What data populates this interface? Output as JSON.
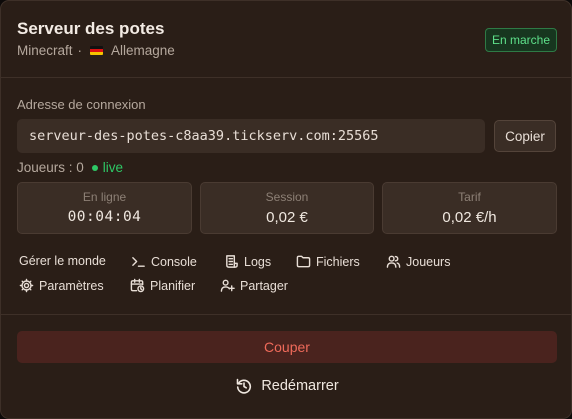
{
  "server": {
    "title": "Serveur des potes",
    "game": "Minecraft",
    "separator": "·",
    "region": "Allemagne",
    "status": "En marche",
    "status_color": "#5ee08a"
  },
  "connection": {
    "label": "Adresse de connexion",
    "address": "serveur-des-potes-c8aa39.tickserv.com:25565",
    "copy_label": "Copier"
  },
  "players": {
    "label": "Joueurs : 0",
    "live_label": "live",
    "live_color": "#2ec866"
  },
  "stats": [
    {
      "label": "En ligne",
      "value": "00:04:04"
    },
    {
      "label": "Session",
      "value": "0,02 €"
    },
    {
      "label": "Tarif",
      "value": "0,02 €/h"
    }
  ],
  "actions": {
    "manage_world": "Gérer le monde",
    "console": "Console",
    "logs": "Logs",
    "files": "Fichiers",
    "players": "Joueurs",
    "settings": "Paramètres",
    "schedule": "Planifier",
    "share": "Partager"
  },
  "buttons": {
    "stop": "Couper",
    "restart": "Redémarrer"
  },
  "icons": [
    "flag-germany-icon",
    "terminal-icon",
    "logs-icon",
    "folder-icon",
    "users-icon",
    "gear-icon",
    "calendar-clock-icon",
    "user-plus-icon",
    "restart-icon"
  ]
}
